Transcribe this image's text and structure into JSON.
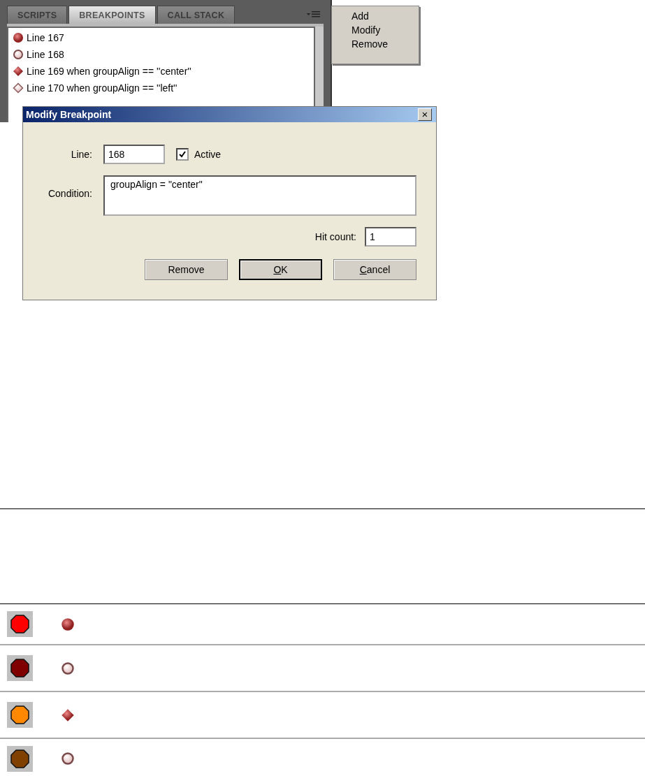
{
  "panel": {
    "tabs": [
      {
        "label": "SCRIPTS",
        "selected": false
      },
      {
        "label": "BREAKPOINTS",
        "selected": true
      },
      {
        "label": "CALL STACK",
        "selected": false
      }
    ],
    "breakpoints": [
      {
        "label": "Line 167",
        "kind": "circle-filled"
      },
      {
        "label": "Line 168",
        "kind": "circle-hollow"
      },
      {
        "label": "Line 169 when groupAlign == ''center''",
        "kind": "diamond-filled"
      },
      {
        "label": "Line 170 when groupAlign == ''left''",
        "kind": "diamond-hollow"
      }
    ]
  },
  "menu": {
    "items": [
      "Add",
      "Modify",
      "Remove"
    ]
  },
  "dialog": {
    "title": "Modify Breakpoint",
    "close": "×",
    "line_label": "Line:",
    "line_value": "168",
    "active_label": "Active",
    "active_checked": true,
    "condition_label": "Condition:",
    "condition_value": "groupAlign = \"center\"",
    "hit_count_label": "Hit count:",
    "hit_count_value": "1",
    "buttons": [
      {
        "label": "Remove",
        "default": false
      },
      {
        "access_key": "O",
        "label_rest": "K",
        "default": true
      },
      {
        "access_key": "C",
        "label_rest": "ancel",
        "default": false
      }
    ]
  },
  "icon_table": {
    "rows": [
      {
        "color": "#ff0000",
        "kind": "circle-filled"
      },
      {
        "color": "#800000",
        "kind": "circle-hollow"
      },
      {
        "color": "#ff8800",
        "kind": "diamond-filled"
      },
      {
        "color": "#804000",
        "kind": "circle-hollow"
      }
    ]
  }
}
